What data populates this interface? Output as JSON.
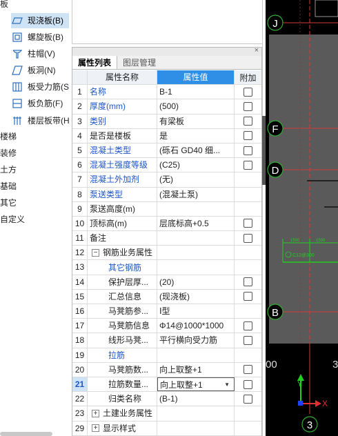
{
  "tree": {
    "root_label": "板",
    "children": [
      {
        "label": "现浇板(B)",
        "icon": "slab-icon",
        "selected": true
      },
      {
        "label": "螺旋板(B)",
        "icon": "spiral-slab-icon"
      },
      {
        "label": "柱帽(V)",
        "icon": "column-cap-icon"
      },
      {
        "label": "板洞(N)",
        "icon": "slab-hole-icon"
      },
      {
        "label": "板受力筋(S",
        "icon": "slab-rebar-icon"
      },
      {
        "label": "板负筋(F)",
        "icon": "negative-rebar-icon"
      },
      {
        "label": "楼层板带(H",
        "icon": "floor-strip-icon"
      }
    ],
    "others": [
      "楼梯",
      "装修",
      "土方",
      "基础",
      "其它",
      "自定义"
    ]
  },
  "panel": {
    "close_label": "×",
    "tabs": [
      "属性列表",
      "图层管理"
    ],
    "headers": {
      "num": "",
      "name": "属性名称",
      "value": "属性值",
      "add": "附加"
    }
  },
  "rows": [
    {
      "num": "1",
      "name": "名称",
      "value": "B-1",
      "blue": true,
      "check": true,
      "level": 0
    },
    {
      "num": "2",
      "name": "厚度(mm)",
      "value": "(500)",
      "blue": true,
      "check": true,
      "level": 0
    },
    {
      "num": "3",
      "name": "类别",
      "value": "有梁板",
      "blue": true,
      "check": true,
      "level": 0
    },
    {
      "num": "4",
      "name": "是否是楼板",
      "value": "是",
      "blue": false,
      "check": true,
      "level": 0
    },
    {
      "num": "5",
      "name": "混凝土类型",
      "value": "(砾石 GD40 细...",
      "blue": true,
      "check": true,
      "level": 0
    },
    {
      "num": "6",
      "name": "混凝土强度等级",
      "value": "(C25)",
      "blue": true,
      "check": true,
      "level": 0
    },
    {
      "num": "7",
      "name": "混凝土外加剂",
      "value": "(无)",
      "blue": true,
      "check": false,
      "level": 0
    },
    {
      "num": "8",
      "name": "泵送类型",
      "value": "(混凝土泵)",
      "blue": true,
      "check": false,
      "level": 0
    },
    {
      "num": "9",
      "name": "泵送高度(m)",
      "value": "",
      "blue": false,
      "check": false,
      "level": 0
    },
    {
      "num": "10",
      "name": "顶标高(m)",
      "value": "层底标高+0.5",
      "blue": false,
      "check": true,
      "level": 0
    },
    {
      "num": "11",
      "name": "备注",
      "value": "",
      "blue": false,
      "check": true,
      "level": 0
    },
    {
      "num": "12",
      "name": "钢筋业务属性",
      "value": "",
      "blue": false,
      "check": false,
      "level": 0,
      "expander": "−"
    },
    {
      "num": "13",
      "name": "其它钢筋",
      "value": "",
      "blue": true,
      "check": false,
      "level": 1
    },
    {
      "num": "14",
      "name": "保护层厚...",
      "value": "(20)",
      "blue": false,
      "check": true,
      "level": 2
    },
    {
      "num": "15",
      "name": "汇总信息",
      "value": "(现浇板)",
      "blue": false,
      "check": true,
      "level": 2
    },
    {
      "num": "16",
      "name": "马凳筋参...",
      "value": "Ⅰ型",
      "blue": false,
      "check": false,
      "level": 2
    },
    {
      "num": "17",
      "name": "马凳筋信息",
      "value": "Φ14@1000*1000",
      "blue": false,
      "check": true,
      "level": 2
    },
    {
      "num": "18",
      "name": "线形马凳...",
      "value": "平行横向受力筋",
      "blue": false,
      "check": true,
      "level": 2
    },
    {
      "num": "19",
      "name": "拉筋",
      "value": "",
      "blue": true,
      "check": false,
      "level": 1
    },
    {
      "num": "20",
      "name": "马凳筋数...",
      "value": "向上取整+1",
      "blue": false,
      "check": true,
      "level": 2
    },
    {
      "num": "21",
      "name": "拉筋数量...",
      "value": "向上取整+1",
      "blue": false,
      "check": true,
      "level": 2,
      "selected": true
    },
    {
      "num": "22",
      "name": "归类名称",
      "value": "(B-1)",
      "blue": false,
      "check": true,
      "level": 2
    },
    {
      "num": "23",
      "name": "土建业务属性",
      "value": "",
      "blue": false,
      "check": false,
      "level": 0,
      "expander": "+"
    },
    {
      "num": "29",
      "name": "显示样式",
      "value": "",
      "blue": false,
      "check": false,
      "level": 0,
      "expander": "+"
    }
  ],
  "cad": {
    "axis_labels": [
      "J",
      "F",
      "D",
      "B"
    ],
    "bottom_axis_label": "3",
    "rebar_tag": "C12@300",
    "dim_left": "1500",
    "dim_right": "1500",
    "coord_left": "00",
    "coord_right": "3",
    "axis_x": "X",
    "axis_y": "Y",
    "colors": {
      "background": "#000000",
      "axis_circle": "#2fae2f",
      "axis_line": "#d23a3a",
      "slab_fill": "#5a5a5a",
      "rebar": "#20d020"
    }
  }
}
